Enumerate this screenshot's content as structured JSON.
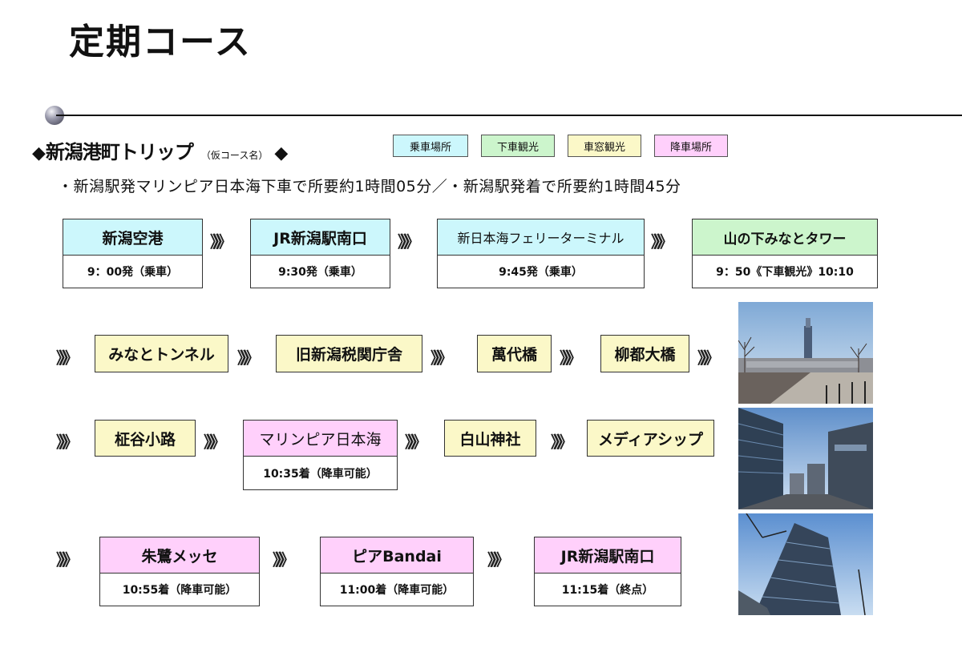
{
  "title": "定期コース",
  "course": {
    "diamond_left": "◆",
    "name": "新潟港町トリップ",
    "tag": "（仮コース名）",
    "diamond_right": "◆"
  },
  "legend": {
    "ride": "乗車場所",
    "sight": "下車観光",
    "window": "車窓観光",
    "drop": "降車場所"
  },
  "note": "・新潟駅発マリンピア日本海下車で所要約1時間05分／・新潟駅発着で所要約1時間45分",
  "arrow": "》》》",
  "stops": {
    "niigata_airport": {
      "name": "新潟空港",
      "time": "9：00発（乗車）"
    },
    "jr_niigata_south": {
      "name": "JR新潟駅南口",
      "time": "9:30発（乗車）"
    },
    "ferry_terminal": {
      "name": "新日本海フェリーターミナル",
      "time": "9:45発（乗車）"
    },
    "minato_tower": {
      "name": "山の下みなとタワー",
      "time": "9：50《下車観光》10:10"
    },
    "minato_tunnel": {
      "name": "みなとトンネル"
    },
    "old_customs": {
      "name": "旧新潟税関庁舎"
    },
    "bandai_bridge": {
      "name": "萬代橋"
    },
    "ryuto_bridge": {
      "name": "柳都大橋"
    },
    "masaya_koji": {
      "name": "柾谷小路"
    },
    "marinepia": {
      "name": "マリンピア日本海",
      "time": "10:35着（降車可能）"
    },
    "hakusan_shrine": {
      "name": "白山神社"
    },
    "media_ship": {
      "name": "メディアシップ"
    },
    "toki_messe": {
      "name": "朱鷺メッセ",
      "time": "10:55着（降車可能）"
    },
    "pia_bandai": {
      "name": "ピアBandai",
      "time": "11:00着（降車可能）"
    },
    "jr_niigata_south_end": {
      "name": "JR新潟駅南口",
      "time": "11:15着（終点）"
    }
  }
}
